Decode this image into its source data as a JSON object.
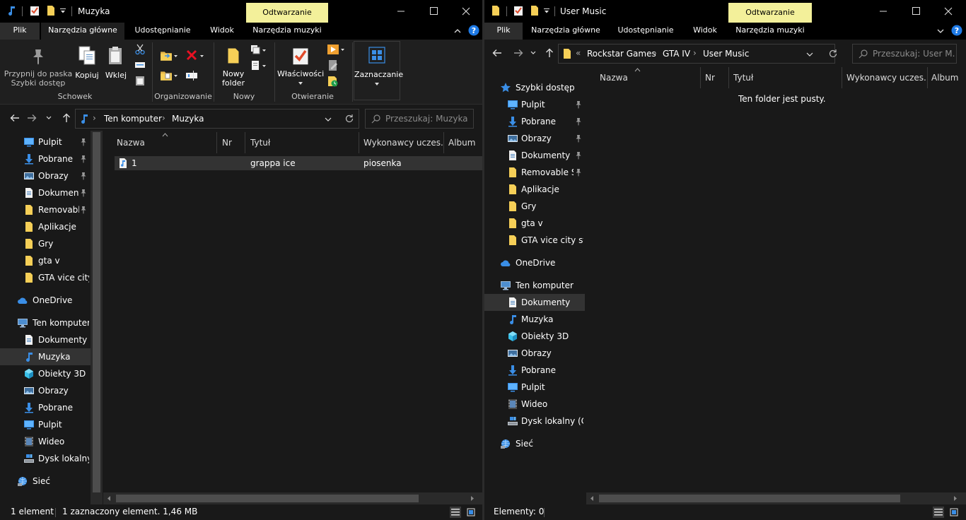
{
  "left": {
    "title": "Muzyka",
    "context_tab": "Odtwarzanie",
    "tabs": [
      "Plik",
      "Narzędzia główne",
      "Udostępnianie",
      "Widok",
      "Narzędzia muzyki"
    ],
    "ribbon": {
      "pin_line1": "Przypnij do paska",
      "pin_line2": "Szybki dostęp",
      "copy": "Kopiuj",
      "paste": "Wklej",
      "group_clipboard": "Schowek",
      "group_organize": "Organizowanie",
      "new_folder_line1": "Nowy",
      "new_folder_line2": "folder",
      "group_new": "Nowy",
      "properties": "Właściwości",
      "group_open": "Otwieranie",
      "select": "Zaznaczanie"
    },
    "breadcrumb": [
      "Ten komputer",
      "Muzyka"
    ],
    "search_placeholder": "Przeszukaj: Muzyka",
    "nav": {
      "quick": [
        {
          "label": "Pulpit",
          "icon": "desktop-icon",
          "pinned": true
        },
        {
          "label": "Pobrane",
          "icon": "download-icon",
          "pinned": true
        },
        {
          "label": "Obrazy",
          "icon": "pictures-icon",
          "pinned": true
        },
        {
          "label": "Dokument",
          "icon": "documents-icon",
          "pinned": true
        },
        {
          "label": "Removable",
          "icon": "folder-icon",
          "pinned": true
        },
        {
          "label": "Aplikacje",
          "icon": "folder-icon",
          "pinned": false
        },
        {
          "label": "Gry",
          "icon": "folder-icon",
          "pinned": false
        },
        {
          "label": "gta v",
          "icon": "folder-icon",
          "pinned": false
        },
        {
          "label": "GTA vice city s",
          "icon": "folder-icon",
          "pinned": false
        }
      ],
      "onedrive": "OneDrive",
      "this_pc": "Ten komputer",
      "pc_items": [
        {
          "label": "Dokumenty",
          "icon": "documents-icon"
        },
        {
          "label": "Muzyka",
          "icon": "music-icon"
        },
        {
          "label": "Obiekty 3D",
          "icon": "objects-3d-icon"
        },
        {
          "label": "Obrazy",
          "icon": "pictures-icon"
        },
        {
          "label": "Pobrane",
          "icon": "download-icon"
        },
        {
          "label": "Pulpit",
          "icon": "desktop-icon"
        },
        {
          "label": "Wideo",
          "icon": "video-icon"
        },
        {
          "label": "Dysk lokalny (",
          "icon": "drive-icon"
        }
      ],
      "network": "Sieć"
    },
    "columns": [
      "Nazwa",
      "Nr",
      "Tytuł",
      "Wykonawcy uczes...",
      "Album"
    ],
    "rows": [
      {
        "name": "1",
        "title": "grappa ice",
        "artist": "piosenka"
      }
    ],
    "status_count": "1 element",
    "status_selected": "1 zaznaczony element. 1,46 MB"
  },
  "right": {
    "title": "User Music",
    "context_tab": "Odtwarzanie",
    "tabs": [
      "Plik",
      "Narzędzia główne",
      "Udostępnianie",
      "Widok",
      "Narzędzia muzyki"
    ],
    "breadcrumb_overflow": "«",
    "breadcrumb": [
      "Rockstar Games",
      "GTA IV",
      "User Music"
    ],
    "search_placeholder": "Przeszukaj: User M...",
    "nav": {
      "quick_access": "Szybki dostęp",
      "quick": [
        {
          "label": "Pulpit",
          "icon": "desktop-icon",
          "pinned": true
        },
        {
          "label": "Pobrane",
          "icon": "download-icon",
          "pinned": true
        },
        {
          "label": "Obrazy",
          "icon": "pictures-icon",
          "pinned": true
        },
        {
          "label": "Dokumenty",
          "icon": "documents-icon",
          "pinned": true
        },
        {
          "label": "Removable St",
          "icon": "folder-icon",
          "pinned": true
        },
        {
          "label": "Aplikacje",
          "icon": "folder-icon",
          "pinned": false
        },
        {
          "label": "Gry",
          "icon": "folder-icon",
          "pinned": false
        },
        {
          "label": "gta v",
          "icon": "folder-icon",
          "pinned": false
        },
        {
          "label": "GTA vice city stor",
          "icon": "folder-icon",
          "pinned": false
        }
      ],
      "onedrive": "OneDrive",
      "this_pc": "Ten komputer",
      "pc_items": [
        {
          "label": "Dokumenty",
          "icon": "documents-icon"
        },
        {
          "label": "Muzyka",
          "icon": "music-icon"
        },
        {
          "label": "Obiekty 3D",
          "icon": "objects-3d-icon"
        },
        {
          "label": "Obrazy",
          "icon": "pictures-icon"
        },
        {
          "label": "Pobrane",
          "icon": "download-icon"
        },
        {
          "label": "Pulpit",
          "icon": "desktop-icon"
        },
        {
          "label": "Wideo",
          "icon": "video-icon"
        },
        {
          "label": "Dysk lokalny (C:)",
          "icon": "drive-icon"
        }
      ],
      "network": "Sieć"
    },
    "columns": [
      "Nazwa",
      "Nr",
      "Tytuł",
      "Wykonawcy uczes...",
      "Album"
    ],
    "empty_message": "Ten folder jest pusty.",
    "status_count": "Elementy: 0"
  },
  "colors": {
    "context_tab": "#f3f09a",
    "folder": "#f6cf57",
    "blue": "#3a8ee6",
    "accent_blue": "#1e90ff"
  }
}
